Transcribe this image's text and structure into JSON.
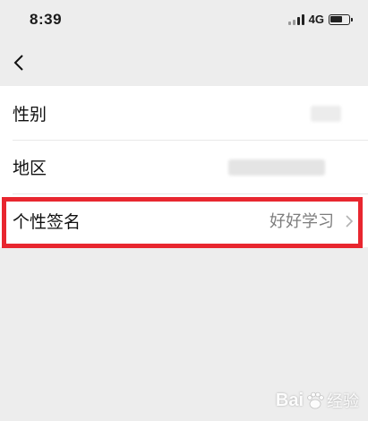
{
  "status_bar": {
    "time": "8:39",
    "network": "4G",
    "battery_level": 0.7
  },
  "nav": {
    "back_icon": "chevron-left-icon"
  },
  "rows": [
    {
      "label": "性别",
      "value": ""
    },
    {
      "label": "地区",
      "value": ""
    },
    {
      "label": "个性签名",
      "value": "好好学习",
      "icon": "chevron-right-icon"
    }
  ],
  "watermark": {
    "brand": "Bai",
    "brand_tail": "经验"
  },
  "colors": {
    "highlight": "#e8262f",
    "background": "#ededed",
    "value_text": "#7d7d7d"
  }
}
